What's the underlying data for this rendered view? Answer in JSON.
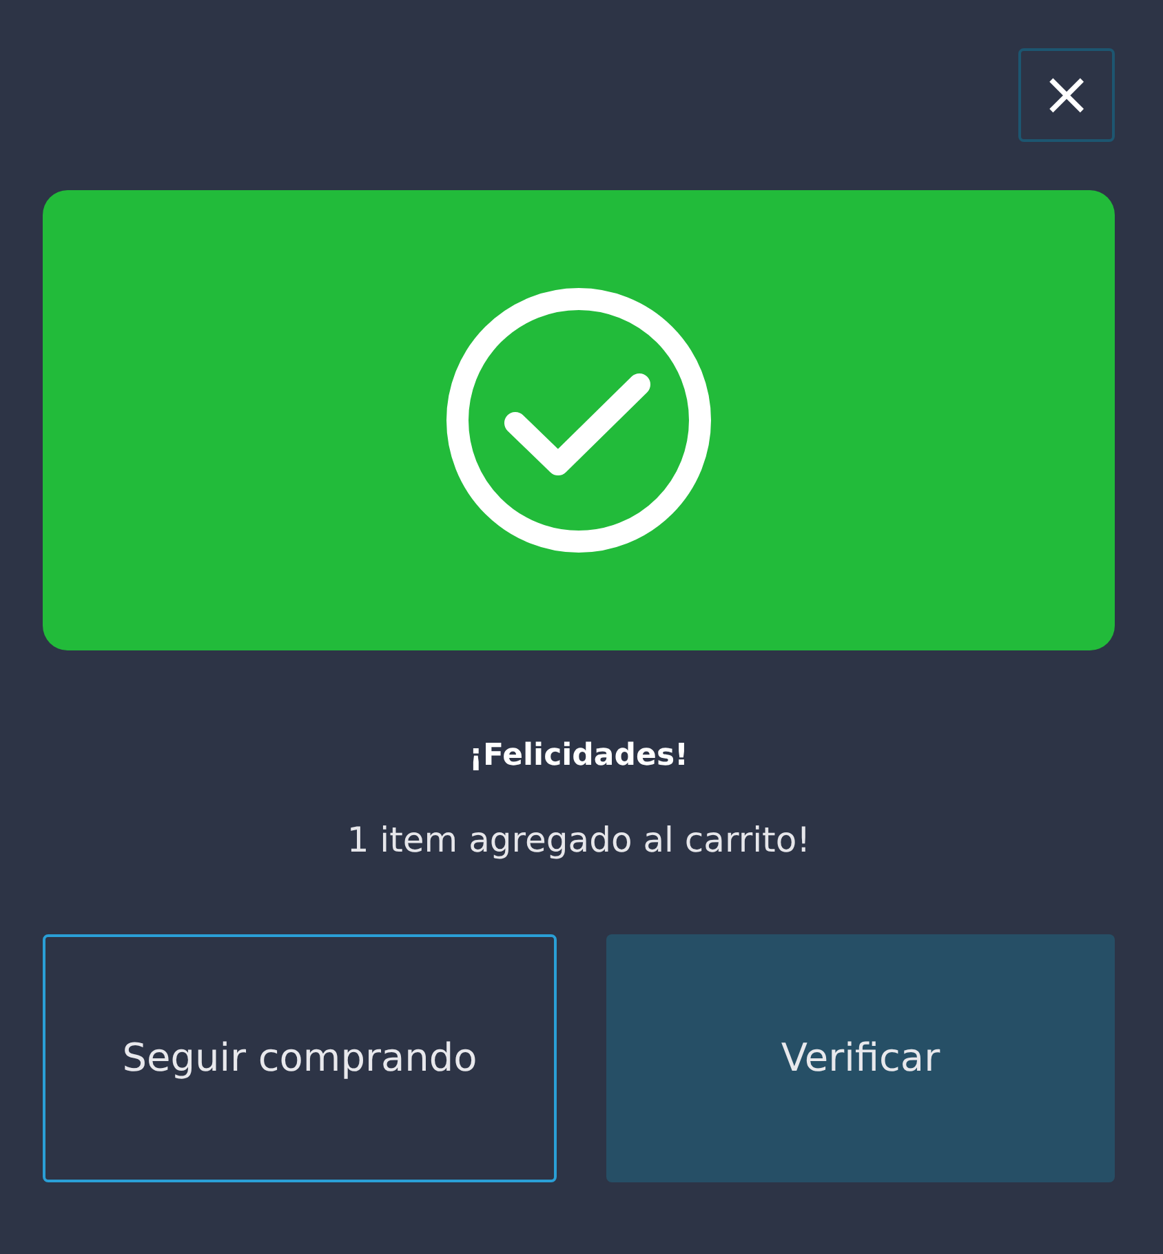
{
  "close_button": {
    "label": "×"
  },
  "title": "¡Felicidades!",
  "message": "1 item agregado al carrito!",
  "buttons": [
    {
      "label": "Seguir comprando",
      "kind": "outline"
    },
    {
      "label": "Verificar",
      "kind": "filled"
    }
  ]
}
